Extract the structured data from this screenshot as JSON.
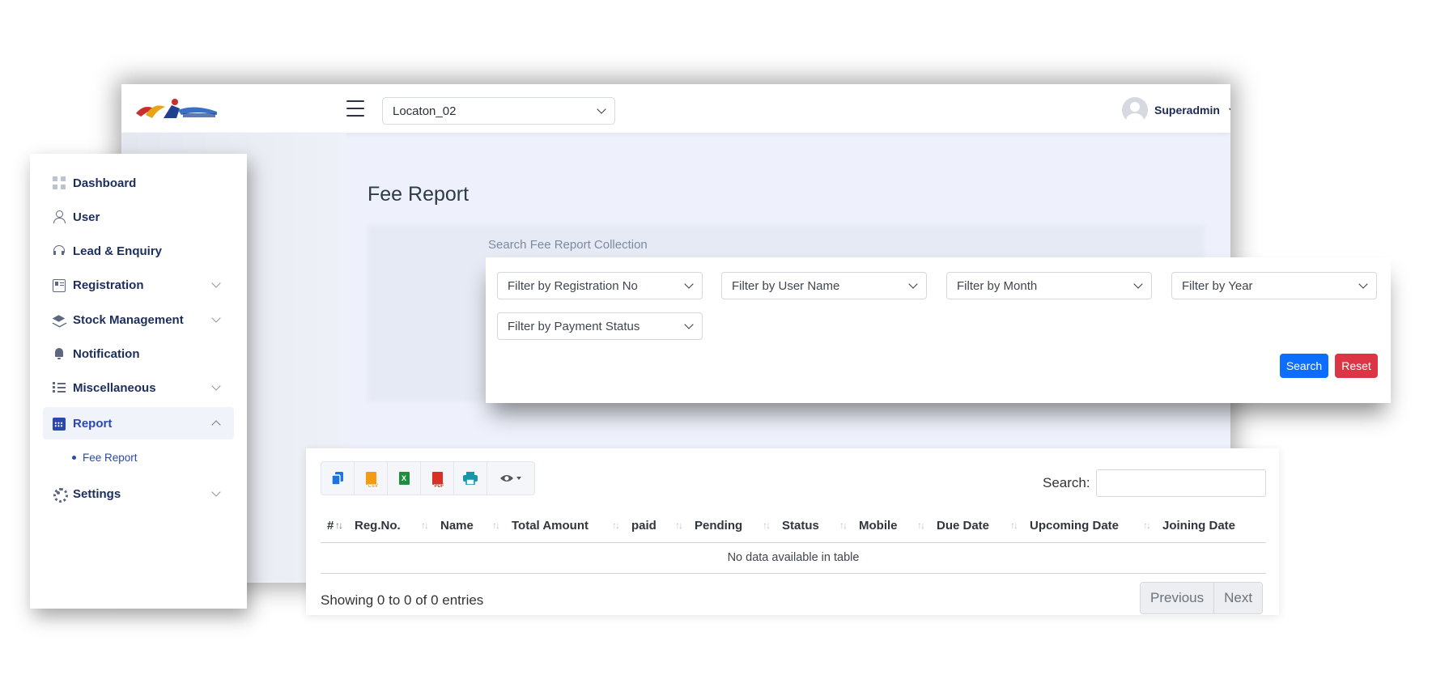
{
  "header": {
    "location_value": "Locaton_02",
    "user_name": "Superadmin"
  },
  "page": {
    "title": "Fee Report",
    "search_heading": "Search Fee Report Collection"
  },
  "sidebar": {
    "items": [
      {
        "label": "Dashboard"
      },
      {
        "label": "User"
      },
      {
        "label": "Lead & Enquiry"
      },
      {
        "label": "Registration"
      },
      {
        "label": "Stock Management"
      },
      {
        "label": "Notification"
      },
      {
        "label": "Miscellaneous"
      },
      {
        "label": "Report"
      },
      {
        "label": "Settings"
      }
    ],
    "sub_item": "Fee Report"
  },
  "filters": {
    "registration": "Filter by Registration No",
    "user_name": "Filter by User Name",
    "month": "Filter by Month",
    "year": "Filter by Year",
    "payment_status": "Filter by Payment Status",
    "search_label": "Search",
    "reset_label": "Reset"
  },
  "table": {
    "search_label": "Search:",
    "columns": [
      "#",
      "Reg.No.",
      "Name",
      "Total Amount",
      "paid",
      "Pending",
      "Status",
      "Mobile",
      "Due Date",
      "Upcoming Date",
      "Joining Date"
    ],
    "empty_message": "No data available in table",
    "entries_info": "Showing 0 to 0 of 0 entries",
    "prev_label": "Previous",
    "next_label": "Next",
    "export": {
      "csv_tag": "CSV",
      "excel_tag": "X",
      "pdf_tag": "PDF"
    }
  },
  "colors": {
    "primary": "#0d6efd",
    "danger": "#dc3545",
    "nav_text": "#1c2e5c",
    "active_link": "#2a48ad"
  }
}
